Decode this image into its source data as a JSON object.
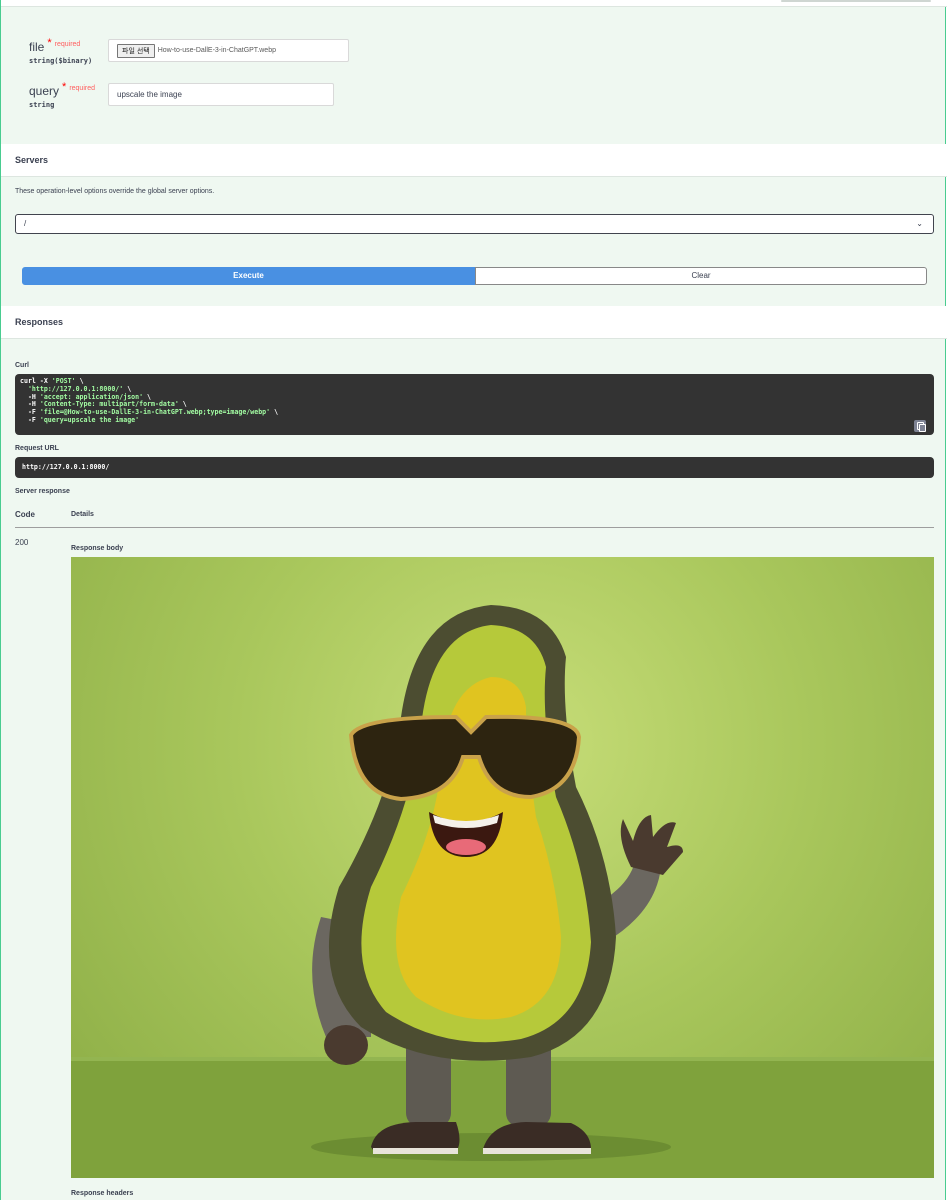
{
  "params": {
    "file": {
      "name": "file",
      "star": "*",
      "required": "required",
      "type": "string($binary)",
      "button_label": "파일 선택",
      "file_name": "How-to-use-DallE-3-in-ChatGPT.webp"
    },
    "query": {
      "name": "query",
      "star": "*",
      "required": "required",
      "type": "string",
      "value": "upscale the image"
    }
  },
  "servers": {
    "title": "Servers",
    "description": "These operation-level options override the global server options.",
    "selected": "/"
  },
  "actions": {
    "execute": "Execute",
    "clear": "Clear"
  },
  "responses": {
    "title": "Responses",
    "curl_label": "Curl",
    "curl": {
      "l1a": "curl -X ",
      "l1b": "'POST'",
      "l1c": " \\",
      "l2a": "  ",
      "l2b": "'http://127.0.0.1:8000/'",
      "l2c": " \\",
      "l3a": "  -H ",
      "l3b": "'accept: application/json'",
      "l3c": " \\",
      "l4a": "  -H ",
      "l4b": "'Content-Type: multipart/form-data'",
      "l4c": " \\",
      "l5a": "  -F ",
      "l5b": "'file=@How-to-use-DallE-3-in-ChatGPT.webp;type=image/webp'",
      "l5c": " \\",
      "l6a": "  -F ",
      "l6b": "'query=upscale the image'"
    },
    "request_url_label": "Request URL",
    "request_url": "http://127.0.0.1:8000/",
    "server_response_label": "Server response",
    "code_header": "Code",
    "details_header": "Details",
    "code": "200",
    "response_body_label": "Response body",
    "response_headers_label": "Response headers"
  },
  "colors": {
    "execute_bg": "#4990e2",
    "opblock_border": "#49cc90",
    "opblock_bg": "#eff8f1",
    "code_bg": "#333333",
    "code_string": "#a2fca2"
  }
}
